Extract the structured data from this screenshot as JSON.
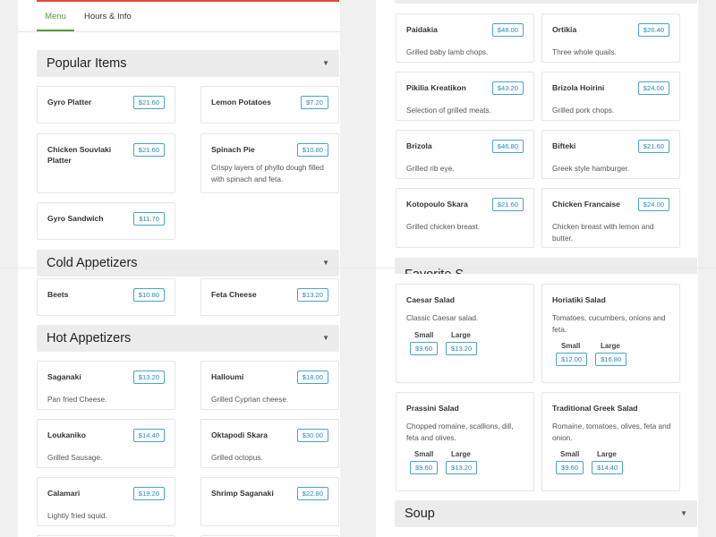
{
  "tabs": {
    "menu": "Menu",
    "hours": "Hours & Info"
  },
  "sections": {
    "popular": "Popular Items",
    "cold": "Cold Appetizers",
    "hot": "Hot Appetizers",
    "salads_partial": "Favorite S",
    "soup": "Soup"
  },
  "chevron": "▼",
  "popular_items": [
    {
      "name": "Gyro Platter",
      "price": "$21.60"
    },
    {
      "name": "Lemon Potatoes",
      "price": "$7.20"
    },
    {
      "name": "Chicken Souvlaki Platter",
      "price": "$21.60"
    },
    {
      "name": "Spinach Pie",
      "price": "$10.80",
      "desc": "Crispy layers of phyllo dough filled with spinach and feta."
    },
    {
      "name": "Gyro Sandwich",
      "price": "$11.70"
    }
  ],
  "cold_items": [
    {
      "name": "Beets",
      "price": "$10.80"
    },
    {
      "name": "Feta Cheese",
      "price": "$13.20"
    }
  ],
  "hot_items": [
    {
      "name": "Saganaki",
      "price": "$13.20",
      "desc": "Pan fried Cheese."
    },
    {
      "name": "Halloumi",
      "price": "$18.00",
      "desc": "Grilled Cyprian cheese."
    },
    {
      "name": "Loukaniko",
      "price": "$14.40",
      "desc": "Grilled Sausage."
    },
    {
      "name": "Oktapodi Skara",
      "price": "$30.00",
      "desc": "Grilled octopus."
    },
    {
      "name": "Calamari",
      "price": "$19.20",
      "desc": "Lightly fried squid."
    },
    {
      "name": "Shrimp Saganaki",
      "price": "$22.80"
    }
  ],
  "grill_items": [
    {
      "name": "Paidakia",
      "price": "$48.00",
      "desc": "Grilled baby lamb chops."
    },
    {
      "name": "Ortikia",
      "price": "$26.40",
      "desc": "Three whole quails."
    },
    {
      "name": "Pikilia Kreatikon",
      "price": "$43.20",
      "desc": "Selection of grilled meats."
    },
    {
      "name": "Brizola Hoirini",
      "price": "$24.00",
      "desc": "Grilled pork chops."
    },
    {
      "name": "Brizola",
      "price": "$46.80",
      "desc": "Grilled rib eye."
    },
    {
      "name": "Bifteki",
      "price": "$21.60",
      "desc": "Greek style hamburger."
    },
    {
      "name": "Kotopoulo Skara",
      "price": "$21.60",
      "desc": "Grilled chicken breast."
    },
    {
      "name": "Chicken Francaise",
      "price": "$24.00",
      "desc": "Chicken breast with lemon and butter."
    }
  ],
  "size_labels": {
    "small": "Small",
    "large": "Large"
  },
  "salad_items": [
    {
      "name": "Caesar Salad",
      "desc": "Classic Caesar salad.",
      "small": "$9.60",
      "large": "$13.20"
    },
    {
      "name": "Horiatiki Salad",
      "desc": "Tomatoes, cucumbers, onions and feta.",
      "small": "$12.00",
      "large": "$16.80"
    },
    {
      "name": "Prassini Salad",
      "desc": "Chopped romaine, scallions, dill, feta and olives.",
      "small": "$9.60",
      "large": "$13.20"
    },
    {
      "name": "Traditional Greek Salad",
      "desc": "Romaine, tomatoes, olives, feta and onion.",
      "small": "$9.60",
      "large": "$14.40"
    }
  ]
}
